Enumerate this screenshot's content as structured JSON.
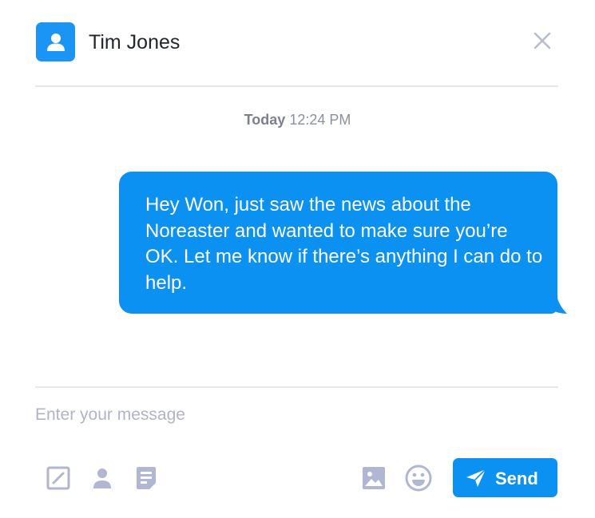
{
  "header": {
    "contact_name": "Tim Jones",
    "avatar_icon": "user-icon",
    "close_icon": "close-icon"
  },
  "conversation": {
    "timestamp_day": "Today",
    "timestamp_time": "12:24 PM",
    "messages": [
      {
        "direction": "outgoing",
        "text": "Hey Won, just saw the news about the Noreaster and wanted to make sure you’re OK. Let me know if there’s anything I can do to help."
      }
    ]
  },
  "composer": {
    "placeholder": "Enter your message",
    "value": "",
    "tools_left": [
      "edit-icon",
      "person-icon",
      "document-icon"
    ],
    "tools_right": [
      "image-icon",
      "emoji-icon"
    ],
    "send_label": "Send",
    "send_icon": "paper-plane-icon"
  },
  "colors": {
    "accent": "#0a91f2",
    "icon": "#b1b6d3",
    "divider": "#e6e7ee",
    "text_muted": "#8c909f"
  }
}
